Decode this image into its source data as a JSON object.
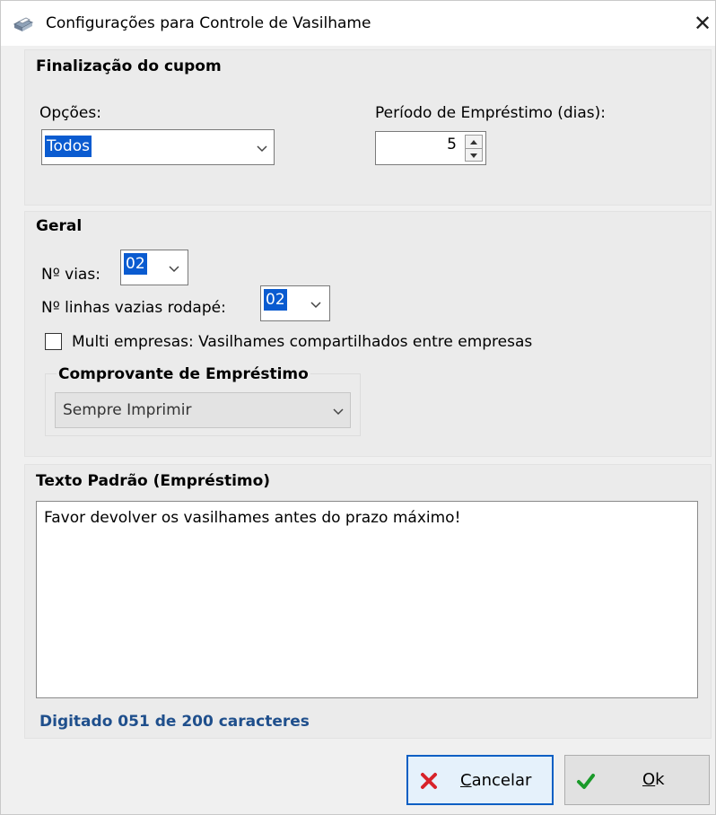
{
  "window": {
    "title": "Configurações para Controle de Vasilhame",
    "close_glyph": "✕",
    "icon": "printer-icon"
  },
  "finalizacao": {
    "group_title": "Finalização do cupom",
    "opcoes_label": "Opções:",
    "opcoes_value": "Todos",
    "periodo_label": "Período de Empréstimo (dias):",
    "periodo_value": "5"
  },
  "geral": {
    "group_title": "Geral",
    "vias_label": "Nº vias:",
    "vias_value": "02",
    "linhas_label": "Nº linhas vazias rodapé:",
    "linhas_value": "02",
    "multi_label": "Multi empresas: Vasilhames compartilhados entre empresas",
    "multi_checked": false,
    "comprovante_title": "Comprovante de Empréstimo",
    "comprovante_value": "Sempre Imprimir"
  },
  "texto": {
    "group_title": "Texto Padrão (Empréstimo)",
    "content": "Favor devolver os vasilhames antes do prazo máximo!",
    "counter": "Digitado 051 de 200 caracteres"
  },
  "buttons": {
    "cancel_accel": "C",
    "cancel_rest": "ancelar",
    "ok_accel": "O",
    "ok_rest": "k"
  },
  "colors": {
    "selection": "#0a5bd0",
    "counter_text": "#1f4f8c",
    "cancel_icon": "#d8232a",
    "ok_icon": "#1a9a2a"
  }
}
